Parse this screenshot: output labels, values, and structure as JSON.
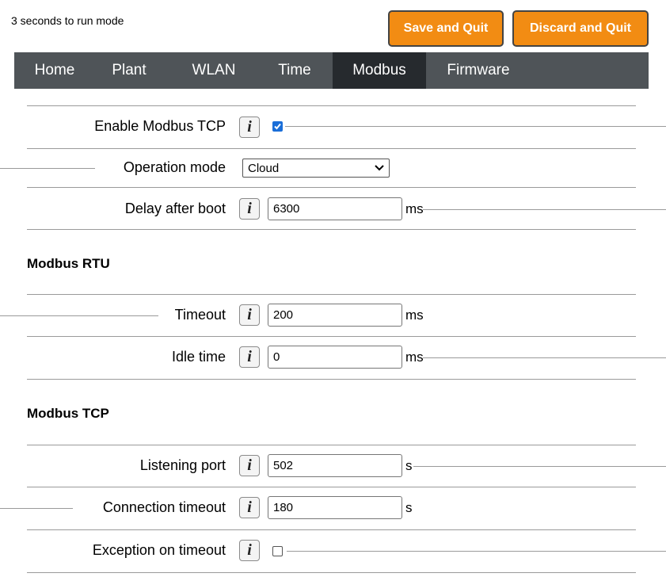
{
  "header": {
    "status_text": "3 seconds to run mode",
    "save_label": "Save and Quit",
    "discard_label": "Discard and Quit",
    "button_color": "#f28c13"
  },
  "nav": {
    "tabs": [
      "Home",
      "Plant",
      "WLAN",
      "Time",
      "Modbus",
      "Firmware"
    ],
    "active": "Modbus"
  },
  "settings": {
    "enable_tcp": {
      "label": "Enable Modbus TCP",
      "checked": true
    },
    "operation_mode": {
      "label": "Operation mode",
      "value": "Cloud"
    },
    "delay_after_boot": {
      "label": "Delay after boot",
      "value": "6300",
      "unit": "ms"
    }
  },
  "rtu": {
    "title": "Modbus RTU",
    "timeout": {
      "label": "Timeout",
      "value": "200",
      "unit": "ms"
    },
    "idle_time": {
      "label": "Idle time",
      "value": "0",
      "unit": "ms"
    }
  },
  "tcp": {
    "title": "Modbus TCP",
    "listening_port": {
      "label": "Listening port",
      "value": "502",
      "unit": "s"
    },
    "connection_timeout": {
      "label": "Connection timeout",
      "value": "180",
      "unit": "s"
    },
    "exception_on_timeout": {
      "label": "Exception on timeout",
      "checked": false
    }
  },
  "icons": {
    "info": "info-icon",
    "checkbox_checked": "checkbox-checked-icon",
    "dropdown": "chevron-down-icon"
  }
}
